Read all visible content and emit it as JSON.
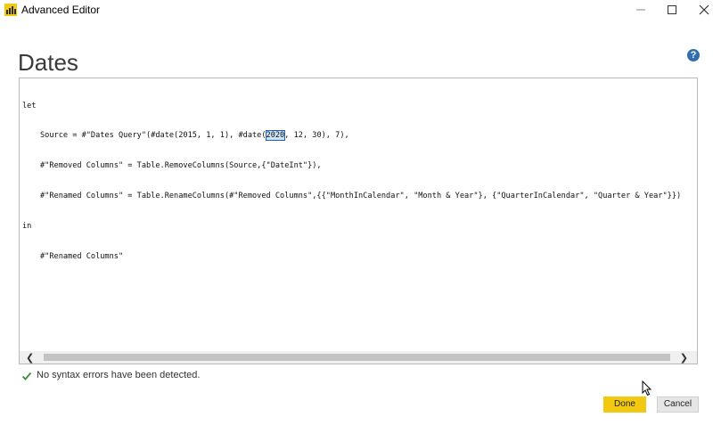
{
  "window": {
    "title": "Advanced Editor",
    "app_icon": "power-bi-icon",
    "controls": [
      "minimize-icon",
      "maximize-icon",
      "close-icon"
    ]
  },
  "page": {
    "title": "Dates",
    "help_icon": "help-icon",
    "help_glyph": "?"
  },
  "editor": {
    "lines": {
      "l1": "let",
      "l2_pre": "Source = #\"Dates Query\"(#date(2015, 1, 1), #date(",
      "l2_sel": "2020",
      "l2_post": ", 12, 30), 7),",
      "l3": "#\"Removed Columns\" = Table.RemoveColumns(Source,{\"DateInt\"}),",
      "l4": "#\"Renamed Columns\" = Table.RenameColumns(#\"Removed Columns\",{{\"MonthInCalendar\", \"Month & Year\"}, {\"QuarterInCalendar\", \"Quarter & Year\"}})",
      "l5": "in",
      "l6": "#\"Renamed Columns\""
    },
    "scroll_left": "❮",
    "scroll_right": "❯"
  },
  "status": {
    "text": "No syntax errors have been detected.",
    "icon": "check-icon",
    "color": "#3a8f3a"
  },
  "buttons": {
    "done": "Done",
    "cancel": "Cancel"
  },
  "colors": {
    "accent": "#f2c811",
    "selection": "#1f63b3",
    "help": "#2f6fb0"
  }
}
